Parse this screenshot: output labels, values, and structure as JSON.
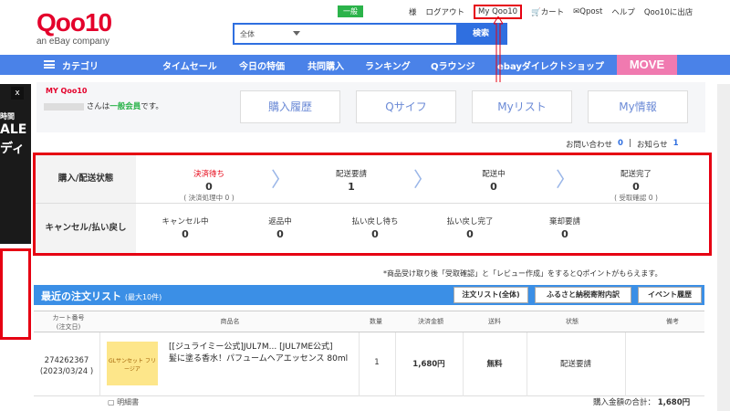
{
  "header": {
    "logo_text": "Qoo10",
    "logo_sub": "an eBay company",
    "member_badge": "一般",
    "links": [
      "様",
      "ログアウト",
      "My Qoo10",
      "カート",
      "Qpost",
      "ヘルプ",
      "Qoo10に出店"
    ],
    "search_category": "全体",
    "search_button": "検索"
  },
  "nav": {
    "category": "カテゴリ",
    "items": [
      "タイムセール",
      "今日の特価",
      "共同購入",
      "ランキング",
      "Qラウンジ",
      "ebayダイレクトショップ"
    ],
    "move": "MOVE"
  },
  "leftad": {
    "close": "x",
    "text1": "時間",
    "text2": "ALE",
    "text3": "ディ"
  },
  "mypanel": {
    "logo": "MY Qoo10",
    "welcome_prefix": "さんは",
    "member_grade": "一般会員",
    "welcome_suffix": "です。",
    "tabs": [
      "購入履歴",
      "Qサイフ",
      "Myリスト",
      "My情報"
    ],
    "contact_label": "お問い合わせ",
    "contact_count": "0",
    "news_label": "お知らせ",
    "news_count": "1"
  },
  "status": {
    "row1_label": "購入/配送状態",
    "row2_label": "キャンセル/払い戻し",
    "row1": [
      {
        "label": "決済待ち",
        "value": "0",
        "note": "( 決済処理中 0 )"
      },
      {
        "label": "配送要請",
        "value": "1",
        "note": ""
      },
      {
        "label": "配送中",
        "value": "0",
        "note": ""
      },
      {
        "label": "配送完了",
        "value": "0",
        "note": "( 受取確認 0 )"
      }
    ],
    "row2": [
      {
        "label": "キャンセル中",
        "value": "0"
      },
      {
        "label": "返品中",
        "value": "0"
      },
      {
        "label": "払い戻し待ち",
        "value": "0"
      },
      {
        "label": "払い戻し完了",
        "value": "0"
      },
      {
        "label": "棄却要請",
        "value": "0"
      }
    ]
  },
  "notice": "*商品受け取り後「受取確認」と「レビュー作成」をするとQポイントがもらえます。",
  "orders": {
    "title": "最近の注文リスト",
    "title_sub": "(最大10件)",
    "buttons": [
      "注文リスト(全体)",
      "ふるさと納税寄附内訳",
      "イベント履歴"
    ],
    "columns": [
      "カート番号\n(注文日)",
      "商品名",
      "数量",
      "決済金額",
      "送料",
      "状態",
      "備考"
    ],
    "row": {
      "cart_no": "274262367",
      "date": "(2023/03/24 )",
      "thumb_text": "GLサンセット フリージア",
      "product_line1": "[[ジュライミー公式]JUL7M... [JUL7ME公式]",
      "product_line2": "髪に塗る香水！パフュームヘアエッセンス 80ml",
      "qty": "1",
      "amount": "1,680円",
      "shipping": "無料",
      "status": "配送要請",
      "memo": ""
    },
    "detail": "明細書",
    "total_label": "購入金額の合計：",
    "total_value": "1,680円"
  }
}
